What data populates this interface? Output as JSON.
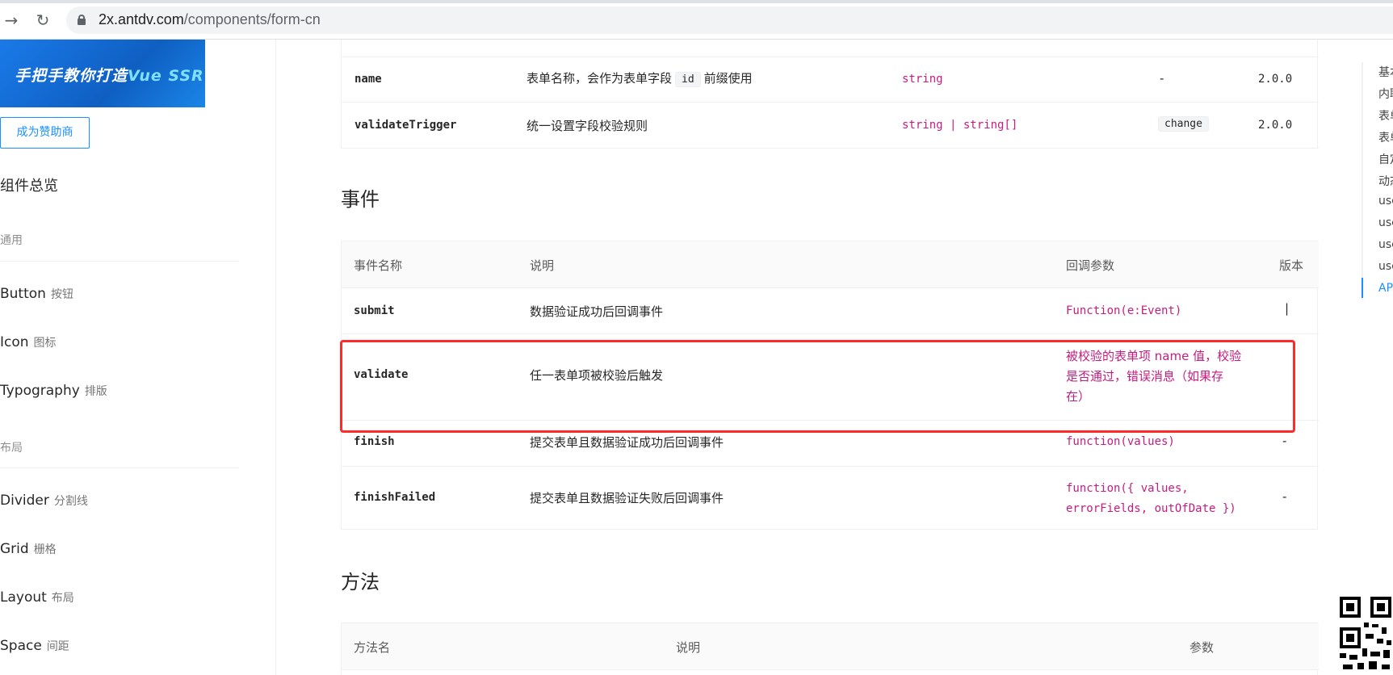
{
  "browser": {
    "url_domain": "2x.antdv.com",
    "url_path": "/components/form-cn",
    "back_icon": "arrow-right-icon",
    "reload_icon": "reload-icon"
  },
  "sidebar": {
    "banner_text_a": "手把手教你打造",
    "banner_text_b": "Vue SSR",
    "sponsor_label": "成为赞助商",
    "overview": "组件总览",
    "groups": [
      {
        "label": "通用"
      },
      {
        "label": "布局"
      }
    ],
    "items": [
      {
        "label": "Button",
        "sub": "按钮"
      },
      {
        "label": "Icon",
        "sub": "图标"
      },
      {
        "label": "Typography",
        "sub": "排版"
      },
      {
        "label": "Divider",
        "sub": "分割线"
      },
      {
        "label": "Grid",
        "sub": "栅格"
      },
      {
        "label": "Layout",
        "sub": "布局"
      },
      {
        "label": "Space",
        "sub": "间距"
      }
    ]
  },
  "props_table": {
    "rows": [
      {
        "name": "name",
        "desc_a": "表单名称，会作为表单字段",
        "chip": "id",
        "desc_b": "前缀使用",
        "type": "string",
        "default": "-",
        "version": "2.0.0"
      },
      {
        "name": "validateTrigger",
        "desc": "统一设置字段校验规则",
        "type": "string | string[]",
        "default_chip": "change",
        "version": "2.0.0"
      }
    ]
  },
  "events": {
    "title": "事件",
    "headers": {
      "name": "事件名称",
      "desc": "说明",
      "params": "回调参数",
      "version": "版本"
    },
    "rows": [
      {
        "name": "submit",
        "desc": "数据验证成功后回调事件",
        "params": "Function(e:Event)",
        "version": "|"
      },
      {
        "name": "validate",
        "desc": "任一表单项被校验后触发",
        "params_line1": "被校验的表单项 name 值，校验",
        "params_line2": "是否通过，错误消息（如果存",
        "params_line3": "在）",
        "version": ""
      },
      {
        "name": "finish",
        "desc": "提交表单且数据验证成功后回调事件",
        "params": "function(values)",
        "version": "-"
      },
      {
        "name": "finishFailed",
        "desc": "提交表单且数据验证失败后回调事件",
        "params_line1": "function({ values,",
        "params_line2": "errorFields, outOfDate })",
        "version": "-"
      }
    ]
  },
  "methods": {
    "title": "方法",
    "headers": {
      "name": "方法名",
      "desc": "说明",
      "params": "参数"
    }
  },
  "anchor": {
    "items": [
      "基本",
      "内联",
      "表单",
      "表单",
      "自定",
      "动态",
      "use",
      "use",
      "use",
      "use",
      "API"
    ],
    "active_index": 10
  },
  "colors": {
    "primary": "#1890ff",
    "type_magenta": "#c41d7f",
    "highlight_red": "#ff2a2a"
  }
}
